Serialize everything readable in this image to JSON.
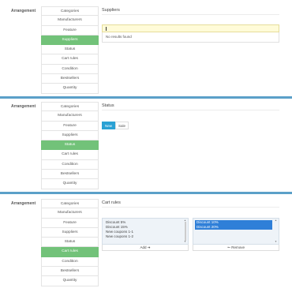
{
  "panels": [
    {
      "arrangement_label": "Arrangement",
      "tabs": [
        "Categories",
        "Manufacturers",
        "Feature",
        "Suppliers",
        "Status",
        "Cart rules",
        "Condition",
        "Bestsellers",
        "Quantity"
      ],
      "active_tab": "Suppliers",
      "title": "Suppliers",
      "search_value": "",
      "no_results_text": "No results found"
    },
    {
      "arrangement_label": "Arrangement",
      "tabs": [
        "Categories",
        "Manufacturers",
        "Feature",
        "Suppliers",
        "Status",
        "Cart rules",
        "Condition",
        "Bestsellers",
        "Quantity"
      ],
      "active_tab": "Status",
      "title": "Status",
      "toggle": {
        "options": [
          "New",
          "Sale"
        ],
        "selected": "New"
      }
    },
    {
      "arrangement_label": "Arrangement",
      "tabs": [
        "Categories",
        "Manufacturers",
        "Feature",
        "Suppliers",
        "Status",
        "Cart rules",
        "Condition",
        "Bestsellers",
        "Quantity"
      ],
      "active_tab": "Cart rules",
      "title": "Cart rules",
      "available": [
        "Discount 5%",
        "Discount 15%",
        "New coupons 1-1",
        "New coupons 1-2"
      ],
      "selected": [
        "Discount 10%",
        "Discount 20%"
      ],
      "add_label": "Add ➔",
      "remove_label": "🠐 Remove"
    }
  ],
  "colors": {
    "active_tab": "#72c279",
    "divider": "#5ba0c8",
    "toggle_active": "#2aa1d4",
    "selected_option": "#2f7fd8",
    "search_bg": "#fffbd8"
  }
}
